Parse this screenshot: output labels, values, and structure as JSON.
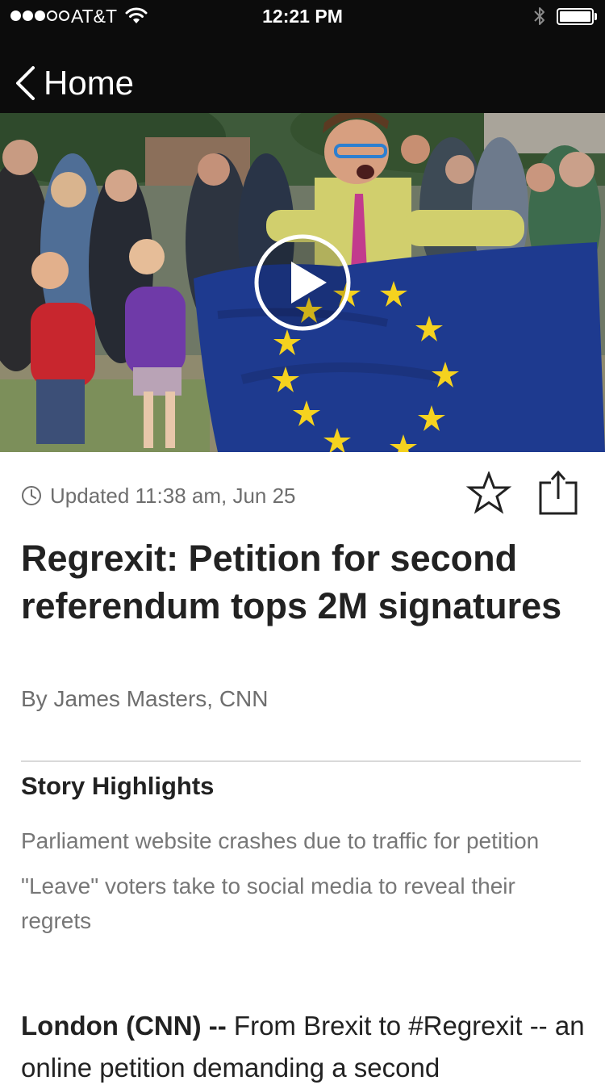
{
  "status_bar": {
    "carrier": "AT&T",
    "time": "12:21 PM",
    "signal_bars": 3,
    "signal_max": 5,
    "battery_level": 0.95
  },
  "nav": {
    "back_label": "Home"
  },
  "article": {
    "updated": "Updated 11:38 am, Jun 25",
    "headline": "Regrexit: Petition for second referendum tops 2M signatures",
    "byline": "By James Masters, CNN",
    "highlights_title": "Story Highlights",
    "highlights": [
      "Parliament website crashes due to traffic for petition",
      "\"Leave\" voters take to social media to reveal their regrets"
    ],
    "body_dateline": "London (CNN) --",
    "body_text": " From Brexit to #Regrexit -- an online petition demanding a second"
  },
  "icons": {
    "back": "chevron-left-icon",
    "play": "play-icon",
    "clock": "clock-icon",
    "favorite": "star-icon",
    "share": "share-icon"
  },
  "colors": {
    "bar_background": "#0c0c0c",
    "headline": "#222222",
    "secondary_text": "#6e6e6e",
    "eu_flag_blue": "#1e3a8f",
    "eu_flag_stars": "#f5d21f"
  }
}
